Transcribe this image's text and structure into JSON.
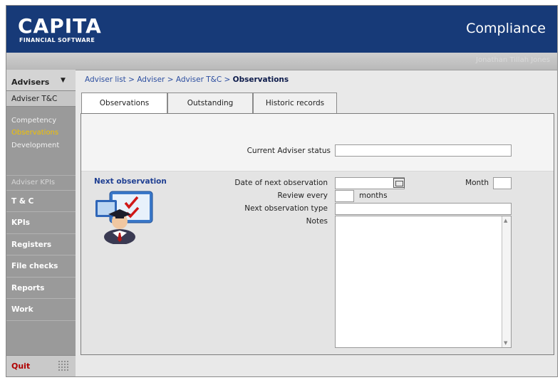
{
  "header": {
    "logo_main": "CAPITA",
    "logo_sub": "FINANCIAL SOFTWARE",
    "app_title": "Compliance",
    "user_name": "Jonathan Tillah Jones"
  },
  "sidebar": {
    "advisers_label": "Advisers",
    "adviser_tc": "Adviser T&C",
    "sub_items": [
      "Competency",
      "Observations",
      "Development"
    ],
    "active_sub": "Observations",
    "kpis_heading": "Adviser KPIs",
    "items": [
      "T & C",
      "KPIs",
      "Registers",
      "File checks",
      "Reports",
      "Work"
    ],
    "quit_label": "Quit"
  },
  "breadcrumb": {
    "links": [
      "Adviser list",
      "Adviser",
      "Adviser T&C"
    ],
    "separator": ">",
    "current": "Observations"
  },
  "tabs": [
    {
      "label": "Observations",
      "active": true
    },
    {
      "label": "Outstanding",
      "active": false
    },
    {
      "label": "Historic records",
      "active": false
    }
  ],
  "form": {
    "current_status_label": "Current Adviser status",
    "current_status_value": "",
    "section_title": "Next observation",
    "date_label": "Date of next observation",
    "date_value": "",
    "month_label": "Month",
    "month_value": "",
    "review_label": "Review every",
    "review_value": "",
    "months_suffix": "months",
    "type_label": "Next observation type",
    "type_value": "",
    "notes_label": "Notes",
    "notes_value": ""
  },
  "colors": {
    "header_bg": "#173a78",
    "link": "#2c4ea0",
    "active_nav": "#f2c200",
    "quit": "#b00000"
  },
  "icons": [
    "dropdown-arrow-icon",
    "calendar-icon",
    "grip-icon",
    "adviser-observation-illustration"
  ]
}
